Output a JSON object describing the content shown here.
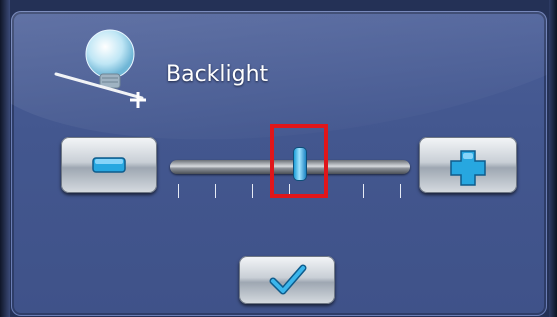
{
  "dialog": {
    "title": "Backlight",
    "icon": "light-bulb-icon"
  },
  "slider": {
    "level_fraction": 0.54,
    "tick_count": 7,
    "highlighted": true
  },
  "buttons": {
    "decrease": "minus-icon",
    "increase": "plus-icon",
    "confirm": "checkmark-icon"
  },
  "colors": {
    "panel": "#4a5e98",
    "accent": "#1d9fd8",
    "highlight": "#e0161a"
  }
}
